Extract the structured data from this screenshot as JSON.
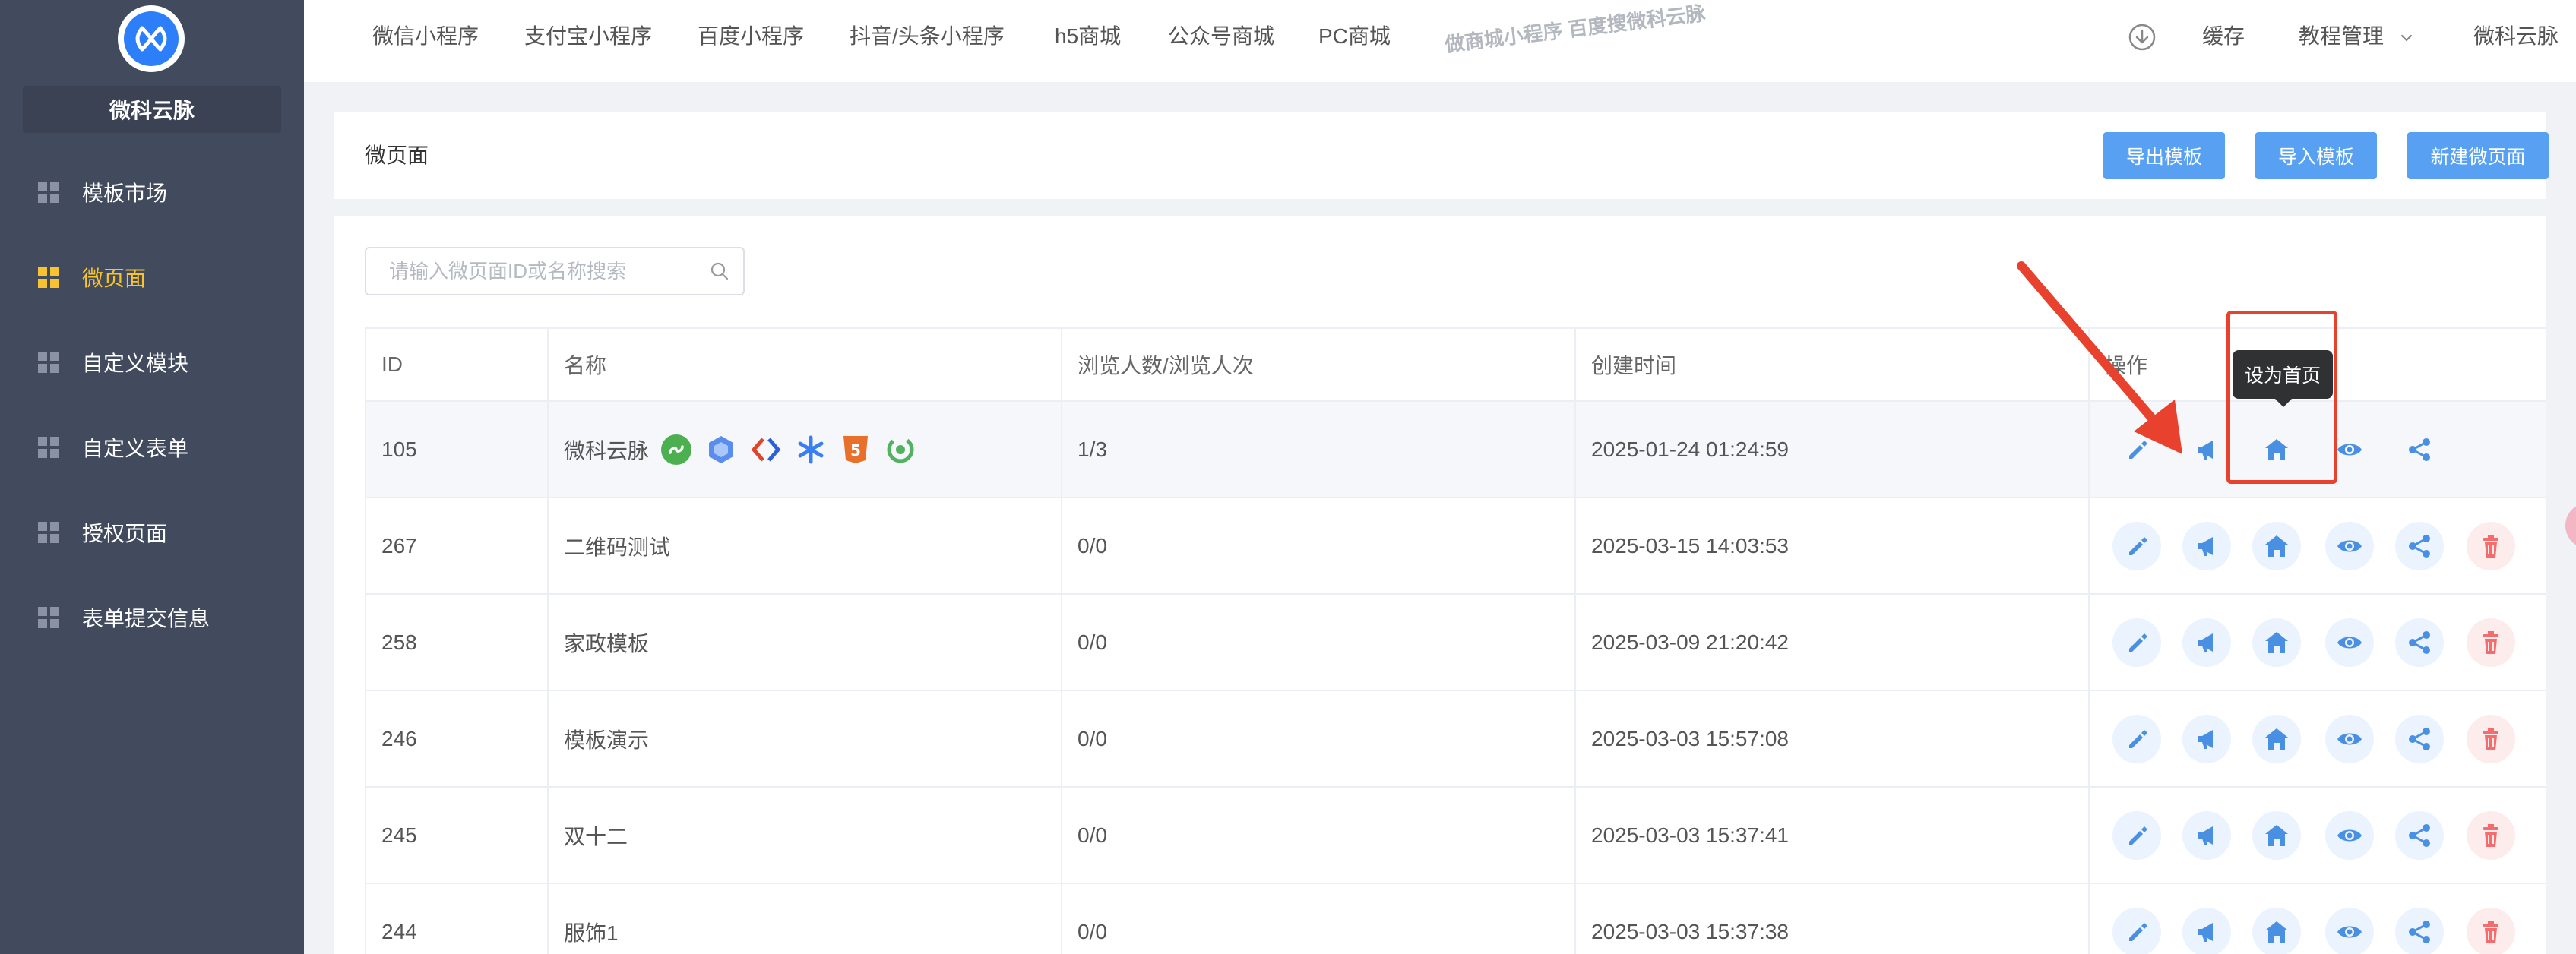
{
  "sidebar": {
    "brand": "微科云脉",
    "items": [
      {
        "label": "模板市场",
        "active": false
      },
      {
        "label": "微页面",
        "active": true
      },
      {
        "label": "自定义模块",
        "active": false
      },
      {
        "label": "自定义表单",
        "active": false
      },
      {
        "label": "授权页面",
        "active": false
      },
      {
        "label": "表单提交信息",
        "active": false
      }
    ]
  },
  "topnav": {
    "items": [
      "微信小程序",
      "支付宝小程序",
      "百度小程序",
      "抖音/头条小程序",
      "h5商城",
      "公众号商城",
      "PC商城"
    ],
    "watermark": "做商城小程序 百度搜微科云脉",
    "cache": "缓存",
    "tutorial": "教程管理",
    "user": "微科云脉"
  },
  "page": {
    "title": "微页面",
    "buttons": {
      "export": "导出模板",
      "import": "导入模板",
      "create": "新建微页面"
    }
  },
  "search": {
    "placeholder": "请输入微页面ID或名称搜索",
    "value": ""
  },
  "table": {
    "headers": {
      "id": "ID",
      "name": "名称",
      "views": "浏览人数/浏览人次",
      "created": "创建时间",
      "ops": "操作"
    },
    "rows": [
      {
        "id": "105",
        "name": "微科云脉",
        "views": "1/3",
        "created": "2025-01-24 01:24:59"
      },
      {
        "id": "267",
        "name": "二维码测试",
        "views": "0/0",
        "created": "2025-03-15 14:03:53"
      },
      {
        "id": "258",
        "name": "家政模板",
        "views": "0/0",
        "created": "2025-03-09 21:20:42"
      },
      {
        "id": "246",
        "name": "模板演示",
        "views": "0/0",
        "created": "2025-03-03 15:57:08"
      },
      {
        "id": "245",
        "name": "双十二",
        "views": "0/0",
        "created": "2025-03-03 15:37:41"
      },
      {
        "id": "244",
        "name": "服饰1",
        "views": "0/0",
        "created": "2025-03-03 15:37:38"
      }
    ]
  },
  "tooltip": {
    "text": "设为首页"
  },
  "colors": {
    "sidebar_bg": "#424b5e",
    "active": "#f7c32e",
    "primary": "#58a1f2",
    "icon_blue": "#4a90e2",
    "danger": "#f56c6c",
    "annotation_red": "#e8412e"
  },
  "icons": {
    "ops": [
      "edit-icon",
      "megaphone-icon",
      "home-icon",
      "eye-icon",
      "share-icon",
      "trash-icon"
    ],
    "channels": [
      "wechat-miniprogram-icon",
      "alipay-icon",
      "baidu-icon",
      "douyin-icon",
      "h5-icon",
      "wechat-official-icon"
    ]
  }
}
